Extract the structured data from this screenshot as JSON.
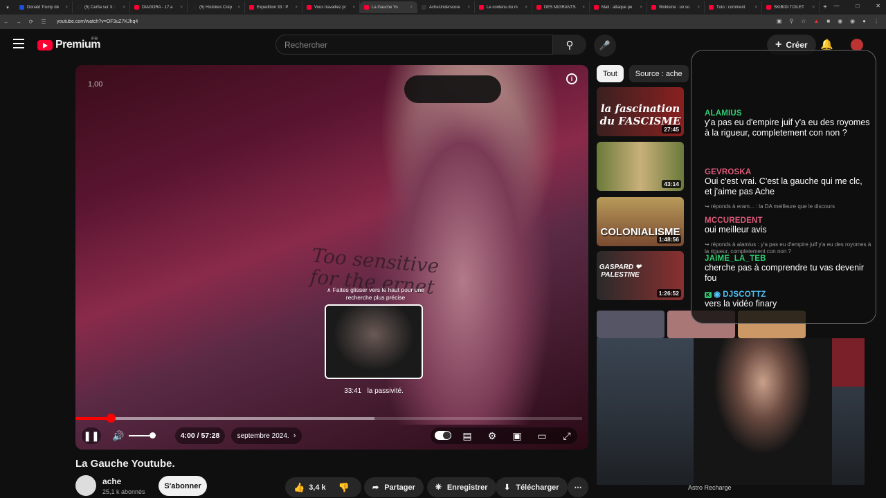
{
  "browser": {
    "tabs": [
      {
        "label": "Donald Trump dé",
        "color": "#1d4ed8"
      },
      {
        "label": "(5) Cerfia sur X :",
        "color": "#222222"
      },
      {
        "label": "DIAGORA - 17 a",
        "color": "#ff0033"
      },
      {
        "label": "(5) Histoires Crép",
        "color": "#222222"
      },
      {
        "label": "Expedition 33 : P",
        "color": "#ff0033"
      },
      {
        "label": "Vous travaillez pl",
        "color": "#ff0033"
      },
      {
        "label": "La Gauche Yo",
        "color": "#ff0033",
        "active": true
      },
      {
        "label": "AcheUnderscore",
        "color": "#333333"
      },
      {
        "label": "Le contenu du m",
        "color": "#ff0033"
      },
      {
        "label": "DES MIGRANTS",
        "color": "#ff0033"
      },
      {
        "label": "Mali : attaque pe",
        "color": "#ff0033"
      },
      {
        "label": "Wokisme : un so",
        "color": "#ff0033"
      },
      {
        "label": "Tuto : comment",
        "color": "#ff0033"
      },
      {
        "label": "SKIBIDI TOILET",
        "color": "#ff0033"
      }
    ],
    "url": "youtube.com/watch?v=OF3uZ7KJhq4"
  },
  "header": {
    "logo": "Premium",
    "region": "FR",
    "search_placeholder": "Rechercher",
    "create": "Créer"
  },
  "player": {
    "speed": "1,00",
    "hint": "∧ Faites glisser vers le haut pour une recherche plus précise",
    "preview_time": "33:41",
    "preview_chapter": "la passivité.",
    "time": "4:00 / 57:28",
    "chapter": "septembre 2024.",
    "progress_played": 0.07,
    "progress_buffered": 0.59,
    "volume": 1.0,
    "shirt_text": "Too sensitive for the ernet"
  },
  "video": {
    "title": "La Gauche Youtube.",
    "channel": "ache",
    "subscribers": "25,1 k abonnés",
    "subscribe": "S'abonner",
    "likes": "3,4 k",
    "share": "Partager",
    "save": "Enregistrer",
    "download": "Télécharger"
  },
  "chips": [
    "Tout",
    "Source : ache"
  ],
  "recommendations": [
    {
      "thumb_text": "la fascination du FASCISME",
      "duration": "27:45"
    },
    {
      "thumb_text": "",
      "duration": "43:14"
    },
    {
      "thumb_text": "COLONIALISME",
      "duration": "1:48:56"
    },
    {
      "thumb_text": "GASPARD ❤ PALESTINE",
      "duration": "1:26:52"
    }
  ],
  "chat": {
    "messages": [
      {
        "user": "ALAMIUS",
        "color": "#2ecc71",
        "text": "y'a pas eu d'empire juif y'a eu des royomes à la rigueur, completement con non ?"
      },
      {
        "user": "GEVROSKA",
        "color": "#e05a7a",
        "text": "Oui c'est vrai. C'est la gauche qui me clc, et j'aime pas Ache"
      },
      {
        "user": "MCCUREDENT",
        "color": "#e05a7a",
        "text": "oui meilleur avis"
      },
      {
        "user": "JAIME_LA_TEB",
        "color": "#2ecc71",
        "text": "cherche pas à comprendre tu vas devenir fou"
      },
      {
        "user": "DJSCOTTZ",
        "color": "#4fc3f7",
        "text": "vers la vidéo finary"
      }
    ],
    "replies": [
      "↪ réponds à eram... : la DA meilleure que le discours",
      "↪ réponds à alamius : y'a pas eu d'empire juif y'a eu des royomes à la rigueur, completement con non ?"
    ]
  },
  "webcam": {
    "label": "Astro Recharge"
  }
}
